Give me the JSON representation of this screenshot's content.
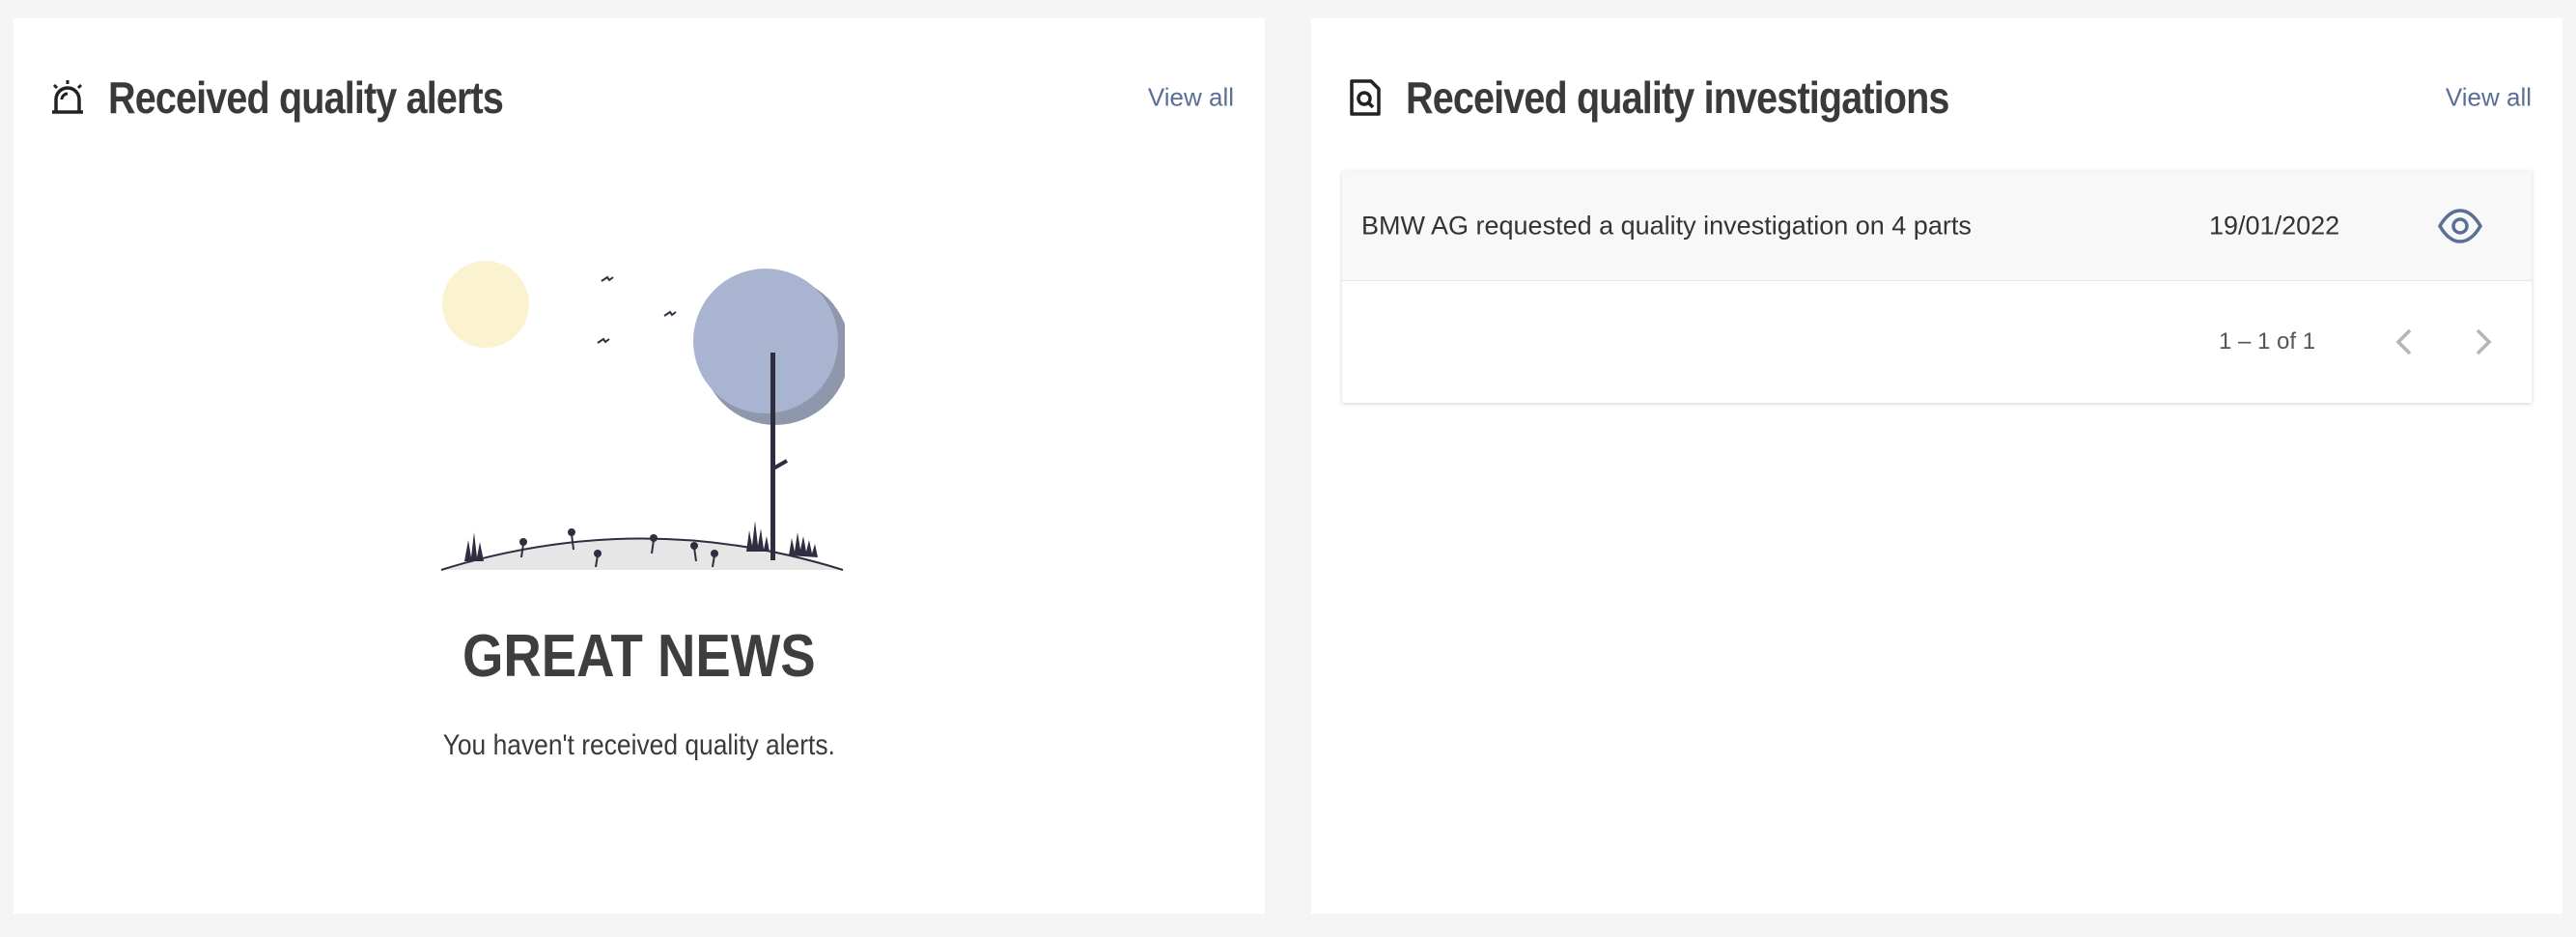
{
  "alerts": {
    "title": "Received quality alerts",
    "view_all": "View all",
    "empty_title": "GREAT NEWS",
    "empty_message": "You haven't received quality alerts.",
    "icon": "alarm-icon"
  },
  "investigations": {
    "title": "Received quality investigations",
    "view_all": "View all",
    "icon": "document-search-icon",
    "rows": [
      {
        "description": "BMW AG requested a quality investigation on 4 parts",
        "date": "19/01/2022",
        "action_icon": "eye-icon"
      }
    ],
    "paginator": {
      "range_label": "1 – 1 of 1",
      "prev_icon": "chevron-left-icon",
      "next_icon": "chevron-right-icon"
    }
  },
  "colors": {
    "link": "#5a6f96",
    "accent": "#5a6f96",
    "sun": "#fbf3cf",
    "moon": "#a9b4d1",
    "moon_shadow": "#8e97ab",
    "ground": "#e6e6e6",
    "dark": "#2f2e41"
  }
}
